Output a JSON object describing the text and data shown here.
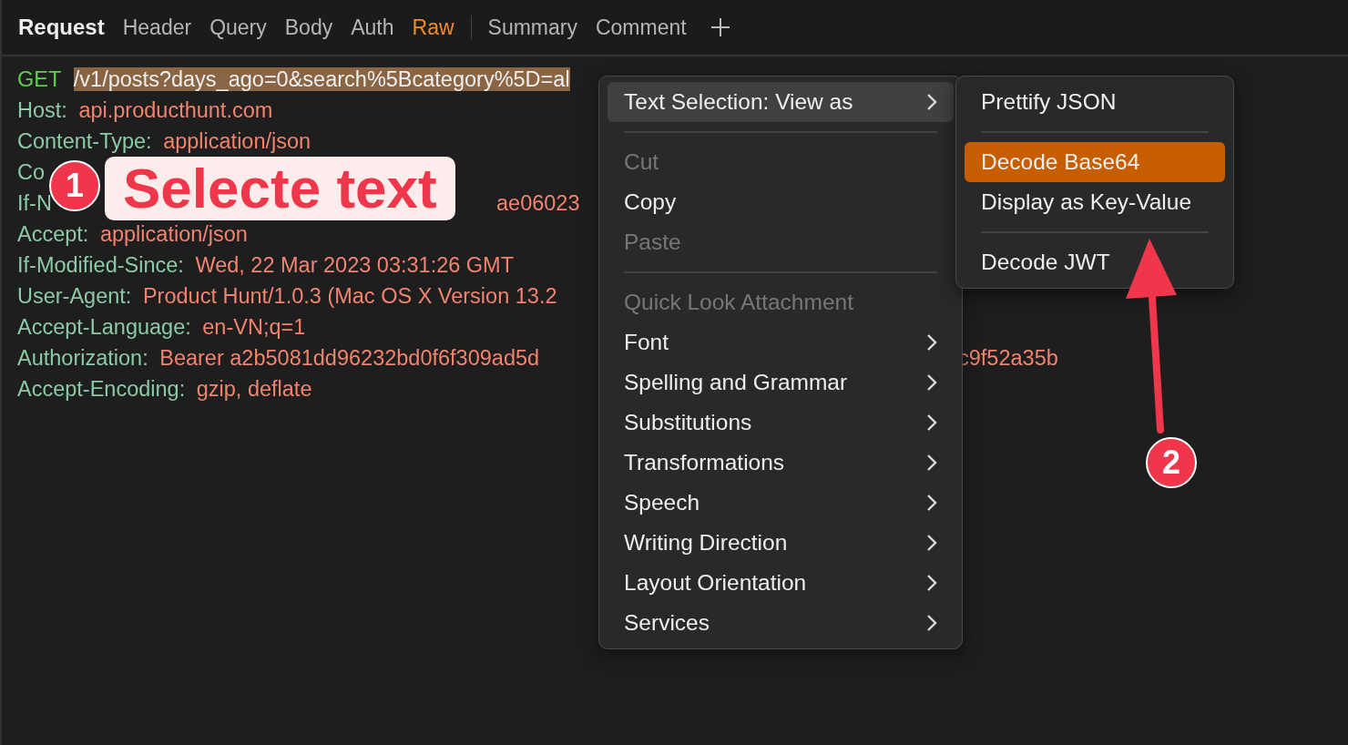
{
  "tabs": [
    {
      "label": "Request",
      "kind": "title"
    },
    {
      "label": "Header",
      "kind": "tab",
      "selected": false
    },
    {
      "label": "Query",
      "kind": "tab",
      "selected": false
    },
    {
      "label": "Body",
      "kind": "tab",
      "selected": false
    },
    {
      "label": "Auth",
      "kind": "tab",
      "selected": false
    },
    {
      "label": "Raw",
      "kind": "tab",
      "selected": true
    },
    {
      "kind": "divider"
    },
    {
      "label": "Summary",
      "kind": "tab",
      "selected": false
    },
    {
      "label": "Comment",
      "kind": "tab",
      "selected": false
    },
    {
      "kind": "add"
    }
  ],
  "request_lines": [
    {
      "kind": "request",
      "key": "GET",
      "value": "/v1/posts?days_ago=0&search%5Bcategory%5D=al",
      "selected": true
    },
    {
      "kind": "header",
      "key": "Host:",
      "value": "api.producthunt.com"
    },
    {
      "kind": "header",
      "key": "Content-Type:",
      "value": "application/json"
    },
    {
      "kind": "header",
      "key": "Co"
    },
    {
      "kind": "header",
      "key": "If-N",
      "tail": "ae06023"
    },
    {
      "kind": "header",
      "key": "Accept:",
      "value": "application/json"
    },
    {
      "kind": "header",
      "key": "If-Modified-Since:",
      "value": "Wed, 22 Mar 2023 03:31:26 GMT"
    },
    {
      "kind": "header",
      "key": "User-Agent:",
      "value": "Product Hunt/1.0.3 (Mac OS X Version 13.2"
    },
    {
      "kind": "header",
      "key": "Accept-Language:",
      "value": "en-VN;q=1"
    },
    {
      "kind": "header",
      "key": "Authorization:",
      "value": "Bearer a2b5081dd96232bd0f6f309ad5d",
      "tail": "c9f52a35b"
    },
    {
      "kind": "header",
      "key": "Accept-Encoding:",
      "value": "gzip, deflate"
    }
  ],
  "context_menu": [
    {
      "kind": "item",
      "label": "Text Selection: View as",
      "submenu": true,
      "selected": true,
      "disabled": false
    },
    {
      "kind": "separator"
    },
    {
      "kind": "item",
      "label": "Cut",
      "submenu": false,
      "selected": false,
      "disabled": true
    },
    {
      "kind": "item",
      "label": "Copy",
      "submenu": false,
      "selected": false,
      "disabled": false
    },
    {
      "kind": "item",
      "label": "Paste",
      "submenu": false,
      "selected": false,
      "disabled": true
    },
    {
      "kind": "separator"
    },
    {
      "kind": "item",
      "label": "Quick Look Attachment",
      "submenu": false,
      "selected": false,
      "disabled": true
    },
    {
      "kind": "item",
      "label": "Font",
      "submenu": true,
      "selected": false,
      "disabled": false
    },
    {
      "kind": "item",
      "label": "Spelling and Grammar",
      "submenu": true,
      "selected": false,
      "disabled": false
    },
    {
      "kind": "item",
      "label": "Substitutions",
      "submenu": true,
      "selected": false,
      "disabled": false
    },
    {
      "kind": "item",
      "label": "Transformations",
      "submenu": true,
      "selected": false,
      "disabled": false
    },
    {
      "kind": "item",
      "label": "Speech",
      "submenu": true,
      "selected": false,
      "disabled": false
    },
    {
      "kind": "item",
      "label": "Writing Direction",
      "submenu": true,
      "selected": false,
      "disabled": false
    },
    {
      "kind": "item",
      "label": "Layout Orientation",
      "submenu": true,
      "selected": false,
      "disabled": false
    },
    {
      "kind": "item",
      "label": "Services",
      "submenu": true,
      "selected": false,
      "disabled": false
    }
  ],
  "submenu": [
    {
      "kind": "item",
      "label": "Prettify JSON",
      "selected": false
    },
    {
      "kind": "separator"
    },
    {
      "kind": "item",
      "label": "Decode Base64",
      "selected": true
    },
    {
      "kind": "item",
      "label": "Display as Key-Value",
      "selected": false
    },
    {
      "kind": "separator"
    },
    {
      "kind": "item",
      "label": "Decode JWT",
      "selected": false
    }
  ],
  "annotations": [
    {
      "number": "1",
      "label": "Selecte text"
    },
    {
      "number": "2"
    }
  ]
}
